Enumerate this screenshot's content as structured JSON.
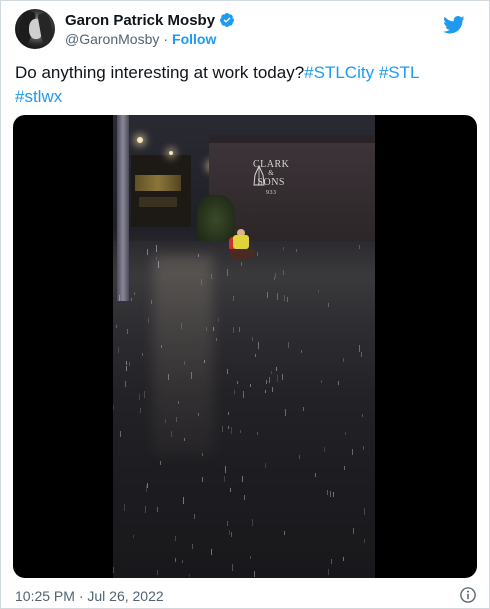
{
  "author": {
    "display_name": "Garon Patrick Mosby",
    "handle": "@GaronMosby",
    "separator": "·",
    "follow_label": "Follow",
    "verified": true
  },
  "tweet": {
    "text_plain": "Do anything interesting at work today?",
    "hashtags": [
      "#STLCity",
      "#STL",
      "#stlwx"
    ]
  },
  "media": {
    "type": "video",
    "sign_line1": "CLARK",
    "sign_line2": "&",
    "sign_line3": "SONS",
    "sign_number": "933"
  },
  "footer": {
    "timestamp": "10:25 PM · Jul 26, 2022"
  },
  "icons": {
    "verified": "verified-badge-icon",
    "brand": "twitter-bird-icon",
    "info": "info-icon"
  },
  "colors": {
    "accent": "#1d9bf0",
    "text": "#0f1419",
    "muted": "#536471",
    "border": "#cfd9de"
  }
}
